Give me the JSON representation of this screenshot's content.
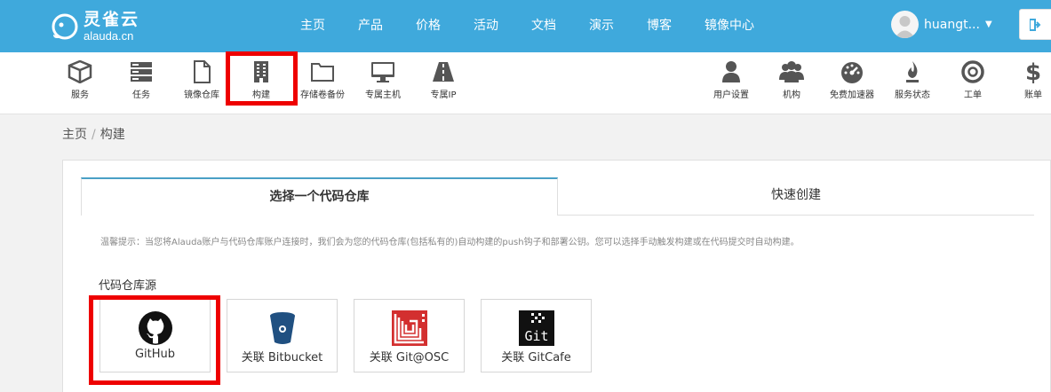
{
  "app": {
    "logo_cn": "灵雀云",
    "logo_en": "alauda.cn",
    "brand_color": "#3fa9dc",
    "highlight_color": "#ee0000"
  },
  "nav": {
    "links": [
      "主页",
      "产品",
      "价格",
      "活动",
      "文档",
      "演示",
      "博客",
      "镜像中心"
    ],
    "user": "huangt..."
  },
  "toolbar": {
    "left": [
      {
        "label": "服务",
        "icon": "cube-icon"
      },
      {
        "label": "任务",
        "icon": "server-list-icon"
      },
      {
        "label": "镜像仓库",
        "icon": "file-icon"
      },
      {
        "label": "构建",
        "icon": "building-icon"
      },
      {
        "label": "存储卷备份",
        "icon": "folder-icon"
      },
      {
        "label": "专属主机",
        "icon": "monitor-icon"
      },
      {
        "label": "专属IP",
        "icon": "road-icon"
      }
    ],
    "right": [
      {
        "label": "用户设置",
        "icon": "user-icon"
      },
      {
        "label": "机构",
        "icon": "users-icon"
      },
      {
        "label": "免费加速器",
        "icon": "dashboard-icon"
      },
      {
        "label": "服务状态",
        "icon": "fire-icon"
      },
      {
        "label": "工单",
        "icon": "lifebuoy-icon"
      },
      {
        "label": "账单",
        "icon": "dollar-icon"
      }
    ]
  },
  "breadcrumb": {
    "home": "主页",
    "separator": "/",
    "current": "构建"
  },
  "tabs": {
    "active": "选择一个代码仓库",
    "inactive": "快速创建"
  },
  "hint": "温馨提示：当您将Alauda账户与代码仓库账户连接时，我们会为您的代码仓库(包括私有的)自动构建的push钩子和部署公钥。您可以选择手动触发构建或在代码提交时自动构建。",
  "section_title": "代码仓库源",
  "repos": [
    {
      "label": "GitHub",
      "icon": "github-icon"
    },
    {
      "label": "关联 Bitbucket",
      "icon": "bitbucket-icon"
    },
    {
      "label": "关联 Git@OSC",
      "icon": "git-osc-icon"
    },
    {
      "label": "关联 GitCafe",
      "icon": "gitcafe-icon"
    }
  ]
}
